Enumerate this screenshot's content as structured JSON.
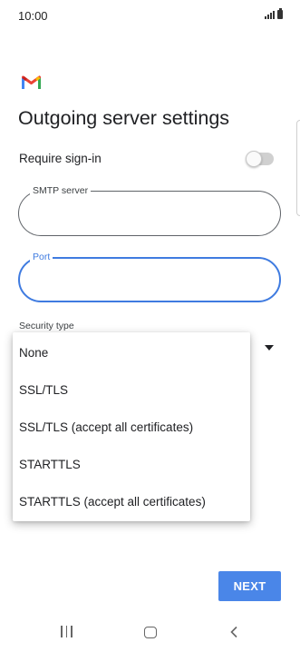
{
  "status_bar": {
    "time": "10:00"
  },
  "page": {
    "title": "Outgoing server settings"
  },
  "require_signin": {
    "label": "Require sign-in",
    "enabled": false
  },
  "smtp_server": {
    "label": "SMTP server",
    "value": ""
  },
  "port": {
    "label": "Port",
    "value": "",
    "focused": true
  },
  "security_type": {
    "label": "Security type",
    "options": [
      "None",
      "SSL/TLS",
      "SSL/TLS (accept all certificates)",
      "STARTTLS",
      "STARTTLS (accept all certificates)"
    ]
  },
  "next_button": {
    "label": "NEXT"
  },
  "colors": {
    "accent": "#4a86e8",
    "focus": "#3f7be0",
    "text": "#202124"
  },
  "icons": [
    "gmail-logo-icon",
    "signal-icon",
    "battery-icon",
    "dropdown-arrow-icon",
    "nav-recent-icon",
    "nav-home-icon",
    "nav-back-icon"
  ]
}
